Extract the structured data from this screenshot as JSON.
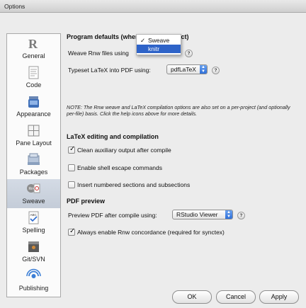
{
  "window": {
    "title": "Options"
  },
  "sidebar": {
    "items": [
      {
        "label": "General",
        "icon": "r-logo-icon"
      },
      {
        "label": "Code",
        "icon": "code-page-icon"
      },
      {
        "label": "Appearance",
        "icon": "paint-jar-icon"
      },
      {
        "label": "Pane Layout",
        "icon": "pane-grid-icon"
      },
      {
        "label": "Packages",
        "icon": "packages-icon"
      },
      {
        "label": "Sweave",
        "icon": "sweave-pdf-icon",
        "active": true
      },
      {
        "label": "Spelling",
        "icon": "spell-check-icon"
      },
      {
        "label": "Git/SVN",
        "icon": "git-svn-icon"
      },
      {
        "label": "Publishing",
        "icon": "publishing-icon"
      }
    ]
  },
  "program_defaults": {
    "header": "Program defaults (when not in a project)",
    "weave_label": "Weave Rnw files using",
    "weave_options": [
      "Sweave",
      "knitr"
    ],
    "weave_selected": "Sweave",
    "weave_highlighted": "knitr",
    "typeset_label": "Typeset LaTeX into PDF using:",
    "typeset_value": "pdfLaTeX",
    "note": "NOTE: The Rnw weave and LaTeX compilation options are also set on a per-project (and optionally per-file) basis. Click the help icons above for more details."
  },
  "latex": {
    "header": "LaTeX editing and compilation",
    "clean_aux": {
      "label": "Clean auxiliary output after compile",
      "checked": true
    },
    "shell_escape": {
      "label": "Enable shell escape commands",
      "checked": false
    },
    "numbered_sections": {
      "label": "Insert numbered sections and subsections",
      "checked": false
    }
  },
  "pdf_preview": {
    "header": "PDF preview",
    "preview_label": "Preview PDF after compile using:",
    "preview_value": "RStudio Viewer",
    "concordance": {
      "label": "Always enable Rnw concordance (required for synctex)",
      "checked": true
    }
  },
  "help_icon": "?",
  "check_mark": "✓",
  "buttons": {
    "ok": "OK",
    "cancel": "Cancel",
    "apply": "Apply"
  },
  "colors": {
    "selection_blue": "#2e63c8",
    "sidebar_active": "#c8d0dc"
  }
}
